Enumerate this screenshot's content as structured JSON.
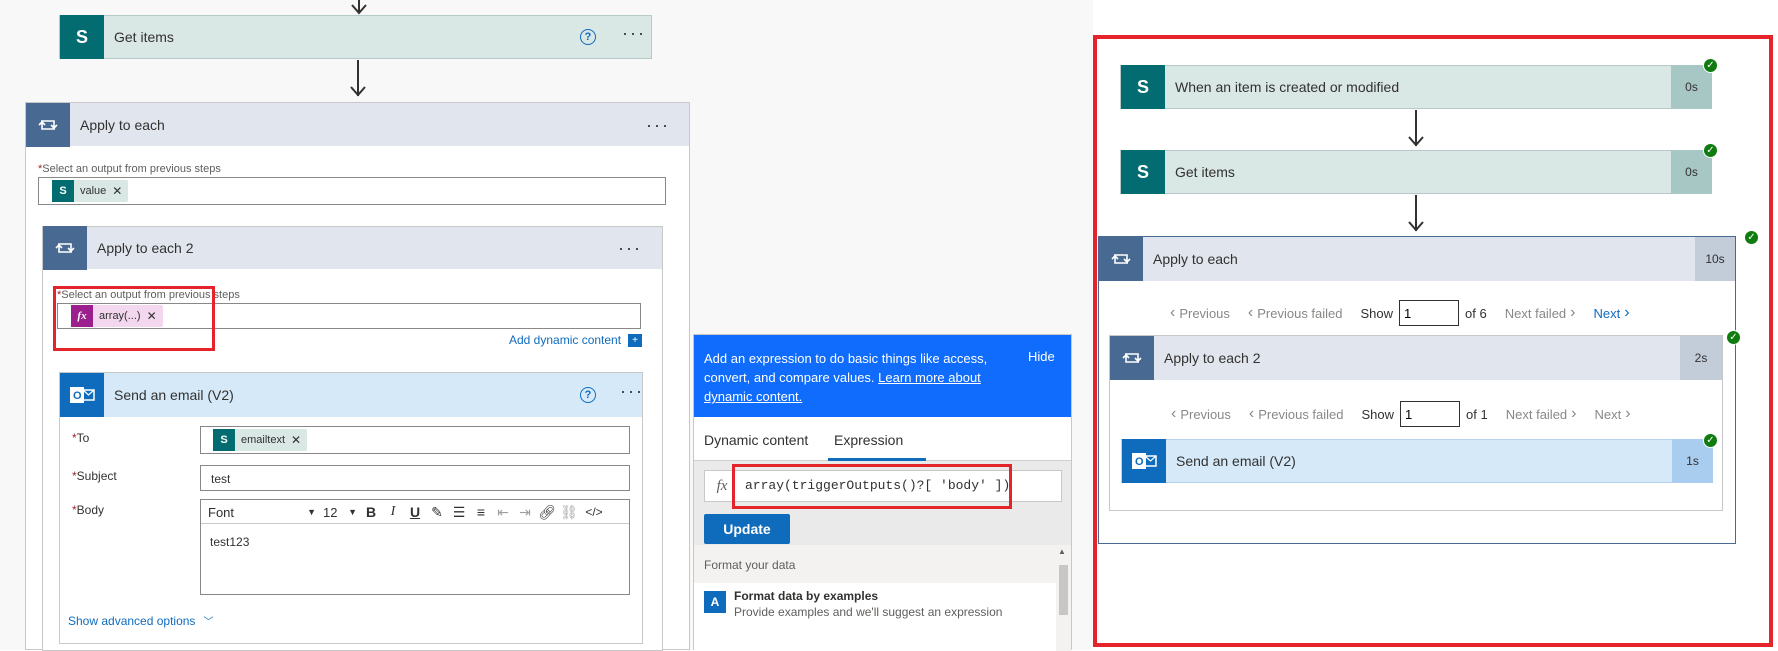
{
  "left": {
    "get_items": {
      "title": "Get items"
    },
    "apply_each": {
      "title": "Apply to each",
      "select_label": "Select an output from previous steps",
      "required_mark": "*",
      "token": "value"
    },
    "apply_each2": {
      "title": "Apply to each 2",
      "select_label": "Select an output from previous steps",
      "required_mark": "*",
      "token": "array(...)",
      "add_dynamic": "Add dynamic content"
    },
    "email": {
      "title": "Send an email (V2)",
      "to_label": "To",
      "to_token": "emailtext",
      "subject_label": "Subject",
      "subject_value": "test",
      "body_label": "Body",
      "font": "Font",
      "font_size": "12",
      "body_value": "test123",
      "advanced": "Show advanced options",
      "required_mark": "*"
    }
  },
  "panel": {
    "info": "Add an expression to do basic things like access, convert, and compare values.",
    "learn_more": "Learn more about dynamic content.",
    "hide": "Hide",
    "tab_dynamic": "Dynamic content",
    "tab_expression": "Expression",
    "fx": "fx",
    "expression": "array(triggerOutputs()?[ 'body' ])",
    "update": "Update",
    "format_header": "Format your data",
    "format_item_title": "Format data by examples",
    "format_item_desc": "Provide examples and we'll suggest an expression"
  },
  "run": {
    "trigger": {
      "title": "When an item is created or modified",
      "duration": "0s"
    },
    "get_items": {
      "title": "Get items",
      "duration": "0s"
    },
    "apply_each": {
      "title": "Apply to each",
      "duration": "10s",
      "previous": "Previous",
      "previous_failed": "Previous failed",
      "show": "Show",
      "page": "1",
      "of": "of 6",
      "next_failed": "Next failed",
      "next": "Next"
    },
    "apply_each2": {
      "title": "Apply to each 2",
      "duration": "2s",
      "previous": "Previous",
      "previous_failed": "Previous failed",
      "show": "Show",
      "page": "1",
      "of": "of 1",
      "next_failed": "Next failed",
      "next": "Next"
    },
    "email": {
      "title": "Send an email (V2)",
      "duration": "1s"
    }
  },
  "icons": {
    "sharepoint": "sharepoint-icon",
    "loop": "loop-icon",
    "outlook": "outlook-icon"
  },
  "colors": {
    "sharepoint": "#036c70",
    "loop": "#486991",
    "outlook": "#0f6cbd",
    "highlight": "#e3242b",
    "panel_blue": "#0f6cfd",
    "success": "#107c10"
  }
}
